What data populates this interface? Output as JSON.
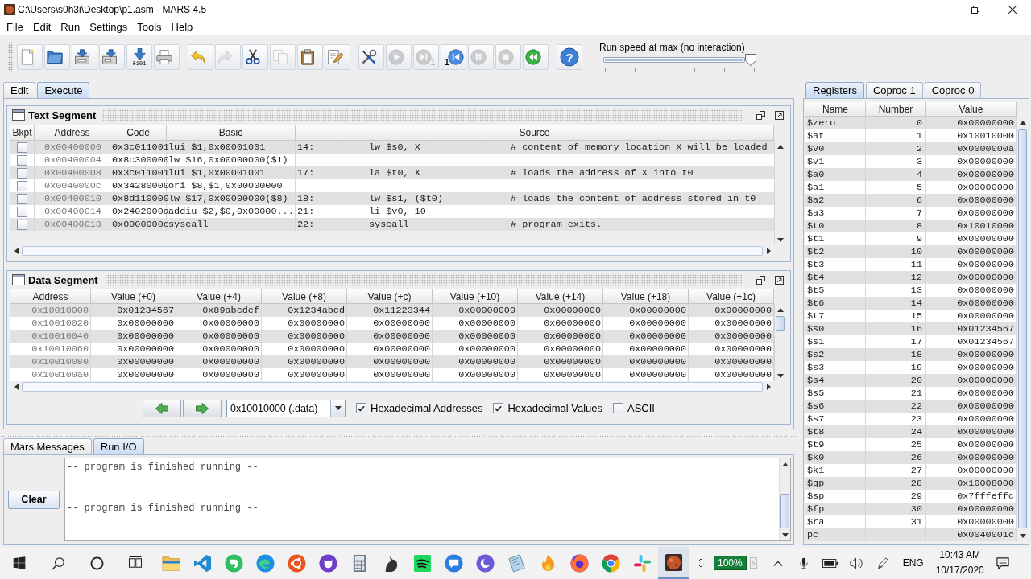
{
  "window": {
    "title": "C:\\Users\\s0h3i\\Desktop\\p1.asm - MARS 4.5"
  },
  "menu": [
    "File",
    "Edit",
    "Run",
    "Settings",
    "Tools",
    "Help"
  ],
  "toolbar": [
    [
      {
        "kind": "new",
        "disabled": false
      },
      {
        "kind": "open",
        "disabled": false
      },
      {
        "kind": "save",
        "disabled": false
      },
      {
        "kind": "save_as",
        "disabled": false
      },
      {
        "kind": "dump",
        "disabled": false,
        "caption": "0101"
      },
      {
        "kind": "print",
        "disabled": false
      }
    ],
    [
      {
        "kind": "undo",
        "disabled": false
      },
      {
        "kind": "redo",
        "disabled": true
      },
      {
        "kind": "cut",
        "disabled": false
      },
      {
        "kind": "copy",
        "disabled": true
      },
      {
        "kind": "paste",
        "disabled": false
      },
      {
        "kind": "find",
        "disabled": false
      }
    ],
    [
      {
        "kind": "assemble",
        "disabled": false
      },
      {
        "kind": "run",
        "disabled": true
      },
      {
        "kind": "step",
        "disabled": true,
        "caption": "1"
      },
      {
        "kind": "backstep",
        "disabled": false,
        "caption": "1"
      },
      {
        "kind": "pause",
        "disabled": true
      },
      {
        "kind": "stop",
        "disabled": true
      },
      {
        "kind": "reset",
        "disabled": false
      }
    ],
    [
      {
        "kind": "help",
        "disabled": false,
        "caption": "?"
      }
    ]
  ],
  "run_speed": {
    "label": "Run speed at max (no interaction)",
    "level": 1
  },
  "tabs": [
    {
      "label": "Edit",
      "selected": false
    },
    {
      "label": "Execute",
      "selected": true
    }
  ],
  "text_segment": {
    "title": "Text Segment",
    "columns": [
      "Bkpt",
      "Address",
      "Code",
      "Basic",
      "Source"
    ],
    "rows": [
      {
        "checked": false,
        "address": "0x00400000",
        "code": "0x3c011001",
        "basic": "lui $1,0x00001001",
        "line": "14:",
        "source": "lw $s0, X",
        "comment": "# content of memory location X will be loaded"
      },
      {
        "checked": false,
        "address": "0x00400004",
        "code": "0x8c300000",
        "basic": "lw $16,0x00000000($1)"
      },
      {
        "checked": false,
        "address": "0x00400008",
        "code": "0x3c011001",
        "basic": "lui $1,0x00001001",
        "line": "17:",
        "source": "la $t0, X",
        "comment": "# loads the address of X into t0"
      },
      {
        "checked": false,
        "address": "0x0040000c",
        "code": "0x34280000",
        "basic": "ori $8,$1,0x00000000"
      },
      {
        "checked": false,
        "address": "0x00400010",
        "code": "0x8d110000",
        "basic": "lw $17,0x00000000($8)",
        "line": "18:",
        "source": "lw $s1, ($t0)",
        "comment": "# loads the content of address stored in t0"
      },
      {
        "checked": false,
        "address": "0x00400014",
        "code": "0x2402000a",
        "basic": "addiu $2,$0,0x00000...",
        "line": "21:",
        "source": "li $v0, 10"
      },
      {
        "checked": false,
        "address": "0x00400018",
        "code": "0x0000000c",
        "basic": "syscall",
        "line": "22:",
        "source": "syscall",
        "comment": "# program exits."
      }
    ]
  },
  "data_segment": {
    "title": "Data Segment",
    "columns": [
      "Address",
      "Value (+0)",
      "Value (+4)",
      "Value (+8)",
      "Value (+c)",
      "Value (+10)",
      "Value (+14)",
      "Value (+18)",
      "Value (+1c)"
    ],
    "rows": [
      {
        "address": "0x10010000",
        "values": [
          "0x01234567",
          "0x89abcdef",
          "0x1234abcd",
          "0x11223344",
          "0x00000000",
          "0x00000000",
          "0x00000000",
          "0x00000000"
        ]
      },
      {
        "address": "0x10010020",
        "values": [
          "0x00000000",
          "0x00000000",
          "0x00000000",
          "0x00000000",
          "0x00000000",
          "0x00000000",
          "0x00000000",
          "0x00000000"
        ]
      },
      {
        "address": "0x10010040",
        "values": [
          "0x00000000",
          "0x00000000",
          "0x00000000",
          "0x00000000",
          "0x00000000",
          "0x00000000",
          "0x00000000",
          "0x00000000"
        ]
      },
      {
        "address": "0x10010060",
        "values": [
          "0x00000000",
          "0x00000000",
          "0x00000000",
          "0x00000000",
          "0x00000000",
          "0x00000000",
          "0x00000000",
          "0x00000000"
        ]
      },
      {
        "address": "0x10010080",
        "values": [
          "0x00000000",
          "0x00000000",
          "0x00000000",
          "0x00000000",
          "0x00000000",
          "0x00000000",
          "0x00000000",
          "0x00000000"
        ]
      },
      {
        "address": "0x100100a0",
        "values": [
          "0x00000000",
          "0x00000000",
          "0x00000000",
          "0x00000000",
          "0x00000000",
          "0x00000000",
          "0x00000000",
          "0x00000000"
        ]
      }
    ],
    "address_select": "0x10010000 (.data)",
    "options": [
      {
        "label": "Hexadecimal Addresses",
        "checked": true
      },
      {
        "label": "Hexadecimal Values",
        "checked": true
      },
      {
        "label": "ASCII",
        "checked": false
      }
    ]
  },
  "register_tabs": [
    {
      "label": "Registers",
      "selected": true
    },
    {
      "label": "Coproc 1",
      "selected": false
    },
    {
      "label": "Coproc 0",
      "selected": false
    }
  ],
  "registers": {
    "columns": [
      "Name",
      "Number",
      "Value"
    ],
    "rows": [
      {
        "name": "$zero",
        "number": "0",
        "value": "0x00000000"
      },
      {
        "name": "$at",
        "number": "1",
        "value": "0x10010000"
      },
      {
        "name": "$v0",
        "number": "2",
        "value": "0x0000000a"
      },
      {
        "name": "$v1",
        "number": "3",
        "value": "0x00000000"
      },
      {
        "name": "$a0",
        "number": "4",
        "value": "0x00000000"
      },
      {
        "name": "$a1",
        "number": "5",
        "value": "0x00000000"
      },
      {
        "name": "$a2",
        "number": "6",
        "value": "0x00000000"
      },
      {
        "name": "$a3",
        "number": "7",
        "value": "0x00000000"
      },
      {
        "name": "$t0",
        "number": "8",
        "value": "0x10010000"
      },
      {
        "name": "$t1",
        "number": "9",
        "value": "0x00000000"
      },
      {
        "name": "$t2",
        "number": "10",
        "value": "0x00000000"
      },
      {
        "name": "$t3",
        "number": "11",
        "value": "0x00000000"
      },
      {
        "name": "$t4",
        "number": "12",
        "value": "0x00000000"
      },
      {
        "name": "$t5",
        "number": "13",
        "value": "0x00000000"
      },
      {
        "name": "$t6",
        "number": "14",
        "value": "0x00000000"
      },
      {
        "name": "$t7",
        "number": "15",
        "value": "0x00000000"
      },
      {
        "name": "$s0",
        "number": "16",
        "value": "0x01234567"
      },
      {
        "name": "$s1",
        "number": "17",
        "value": "0x01234567"
      },
      {
        "name": "$s2",
        "number": "18",
        "value": "0x00000000"
      },
      {
        "name": "$s3",
        "number": "19",
        "value": "0x00000000"
      },
      {
        "name": "$s4",
        "number": "20",
        "value": "0x00000000"
      },
      {
        "name": "$s5",
        "number": "21",
        "value": "0x00000000"
      },
      {
        "name": "$s6",
        "number": "22",
        "value": "0x00000000"
      },
      {
        "name": "$s7",
        "number": "23",
        "value": "0x00000000"
      },
      {
        "name": "$t8",
        "number": "24",
        "value": "0x00000000"
      },
      {
        "name": "$t9",
        "number": "25",
        "value": "0x00000000"
      },
      {
        "name": "$k0",
        "number": "26",
        "value": "0x00000000"
      },
      {
        "name": "$k1",
        "number": "27",
        "value": "0x00000000"
      },
      {
        "name": "$gp",
        "number": "28",
        "value": "0x10008000"
      },
      {
        "name": "$sp",
        "number": "29",
        "value": "0x7fffeffc"
      },
      {
        "name": "$fp",
        "number": "30",
        "value": "0x00000000"
      },
      {
        "name": "$ra",
        "number": "31",
        "value": "0x00000000"
      },
      {
        "name": "pc",
        "value": "0x0040001c"
      }
    ]
  },
  "message_tabs": [
    {
      "label": "Mars Messages",
      "selected": false
    },
    {
      "label": "Run I/O",
      "selected": true
    }
  ],
  "run_io": {
    "button": "Clear",
    "output": [
      "-- program is finished running --",
      "-- program is finished running --"
    ]
  },
  "taskbar": {
    "apps": [
      {
        "active": false
      },
      {
        "active": false
      },
      {
        "active": false
      },
      {
        "active": false
      },
      {
        "active": false
      },
      {
        "active": false
      },
      {
        "active": false
      },
      {
        "active": false
      },
      {
        "active": false
      },
      {
        "active": false
      },
      {
        "active": false
      },
      {
        "active": false
      },
      {
        "active": false
      },
      {
        "active": false
      },
      {
        "active": false
      },
      {
        "active": false
      },
      {
        "active": true
      }
    ],
    "percent": "100%",
    "language": "ENG",
    "time": "10:43 AM",
    "date": "10/17/2020"
  }
}
